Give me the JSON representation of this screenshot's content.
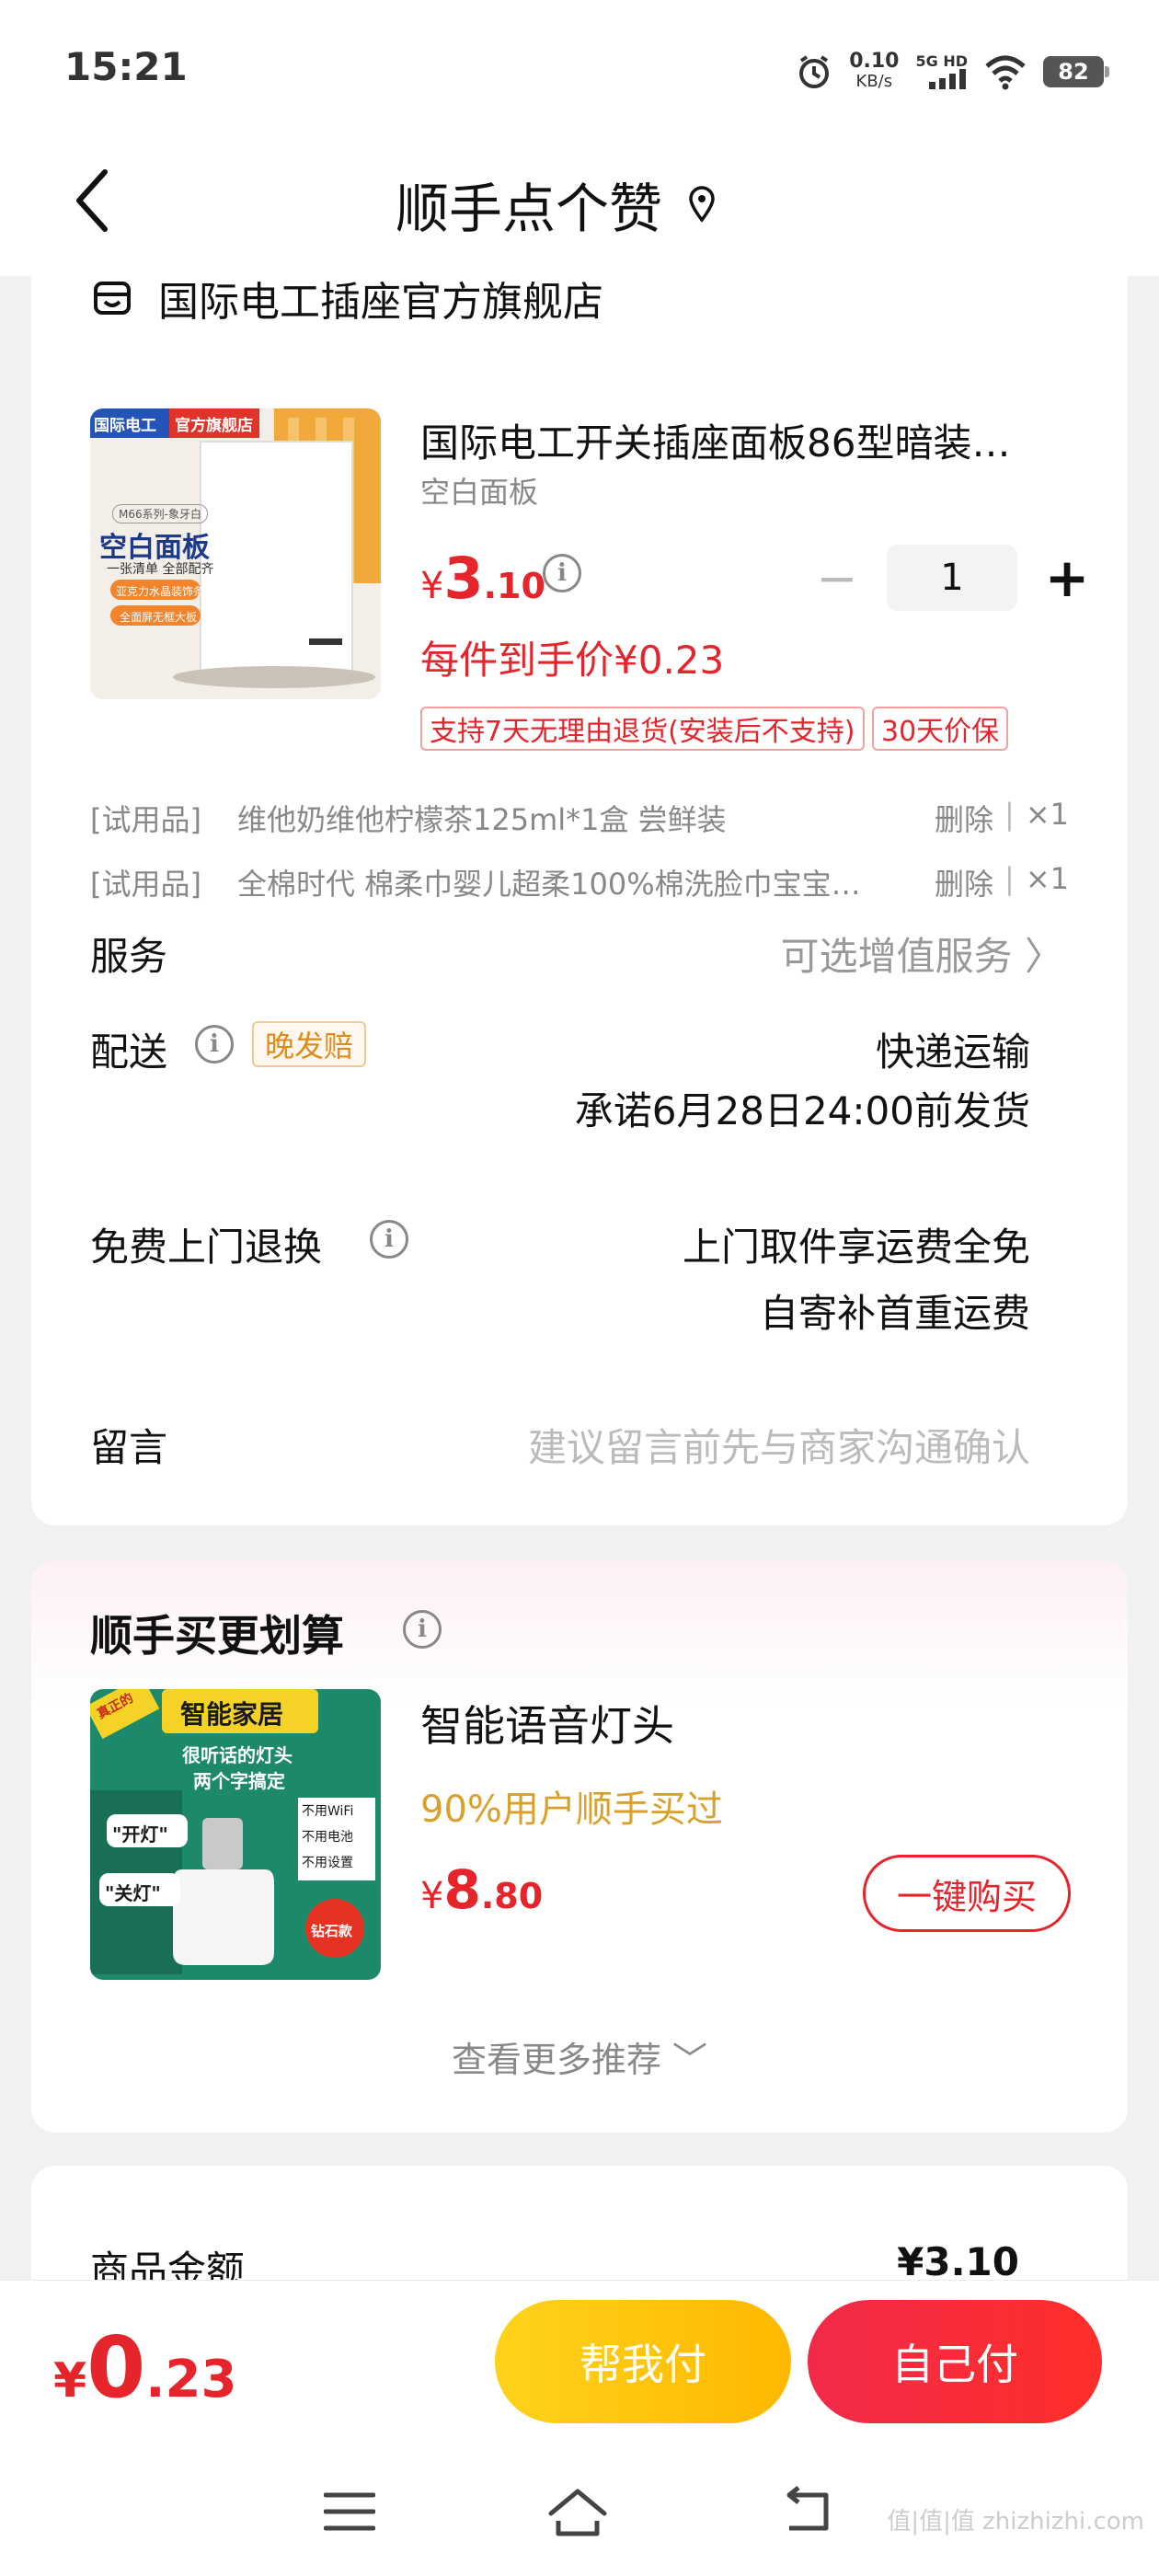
{
  "status_bar": {
    "time": "15:21",
    "net_speed_value": "0.10",
    "net_speed_unit": "KB/s",
    "signal": "5G HD",
    "battery": "82"
  },
  "header": {
    "title": "顺手点个赞"
  },
  "shop": {
    "name": "国际电工插座官方旗舰店"
  },
  "product": {
    "title": "国际电工开关插座面板86型暗装…",
    "spec": "空白面板",
    "price_currency": "¥",
    "price_int": "3",
    "price_dec": ".10",
    "quantity": "1",
    "unit_price": "每件到手价¥0.23",
    "tags": [
      "支持7天无理由退货(安装后不支持)",
      "30天价保"
    ],
    "image_brand": "国际电工",
    "image_store": "官方旗舰店",
    "image_series": "M66系列-象牙白",
    "image_headline": "空白面板",
    "image_sub": "一张清单 全部配齐",
    "image_badge1": "亚克力水晶装饰条",
    "image_badge2": "全面屏无框大板"
  },
  "gifts": [
    {
      "type": "[试用品]",
      "name": "维他奶维他柠檬茶125ml*1盒 尝鲜装",
      "action": "删除",
      "qty": "×1"
    },
    {
      "type": "[试用品]",
      "name": "全棉时代 棉柔巾婴儿超柔100%棉洗脸巾宝宝…",
      "action": "删除",
      "qty": "×1"
    }
  ],
  "service": {
    "label": "服务",
    "value": "可选增值服务 〉"
  },
  "delivery": {
    "label": "配送",
    "badge": "晚发赔",
    "method": "快递运输",
    "promise": "承诺6月28日24:00前发货"
  },
  "return_service": {
    "label": "免费上门退换",
    "line1": "上门取件享运费全免",
    "line2": "自寄补首重运费"
  },
  "message": {
    "label": "留言",
    "placeholder": "建议留言前先与商家沟通确认"
  },
  "upsell": {
    "title": "顺手买更划算",
    "product_name": "智能语音灯头",
    "rate": "90%用户顺手买过",
    "price_currency": "¥",
    "price_int": "8",
    "price_dec": ".80",
    "buy_label": "一键购买",
    "more_label": "查看更多推荐 ﹀",
    "image_banner": "智能家居",
    "image_line1": "很听话的灯头",
    "image_line2": "两个字搞定",
    "image_on": "\"开灯\"",
    "image_off": "\"关灯\"",
    "image_features": [
      "不用WiFi",
      "不用电池",
      "不用设置"
    ],
    "image_corner": "真正的",
    "image_badge": "钻石款"
  },
  "summary": {
    "label": "商品金额",
    "value": "¥3.10"
  },
  "bottom": {
    "total_currency": "¥",
    "total_int": "0",
    "total_dec": ".23",
    "help_pay": "帮我付",
    "self_pay": "自己付"
  },
  "watermark": "值|值|值 zhizhizhi.com",
  "colors": {
    "accent_red": "#e5242b",
    "help_yellow": "#ffc107",
    "rate_gold": "#d9a02c"
  }
}
